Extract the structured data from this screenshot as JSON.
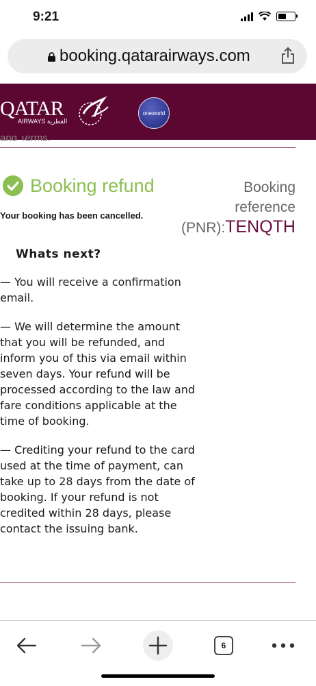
{
  "status": {
    "time": "9:21"
  },
  "browser": {
    "url": "booking.qatarairways.com",
    "tab_count": "6"
  },
  "brand": {
    "logo": "QATAR",
    "logo_sub": "AIRWAYS القطرية",
    "alliance": "oneworld"
  },
  "header": {
    "cutoff_text": "and Terms."
  },
  "refund": {
    "title": "Booking refund",
    "subtitle": "Your booking has been cancelled.",
    "pnr_label_1": "Booking",
    "pnr_label_2": "reference",
    "pnr_label_3": "(PNR):",
    "pnr_value": "TENQTH"
  },
  "next": {
    "title": "Whats next?",
    "items": [
      "— You will receive a confirmation email.",
      "— We will determine the amount that you will be refunded, and inform you of this via email within seven days. Your refund will be processed according to the law and fare conditions applicable at the time of booking.",
      "— Crediting your refund to the card used at the time of payment, can take up to 28 days from the date of booking. If your refund is not credited within 28 days, please contact the issuing bank."
    ]
  }
}
